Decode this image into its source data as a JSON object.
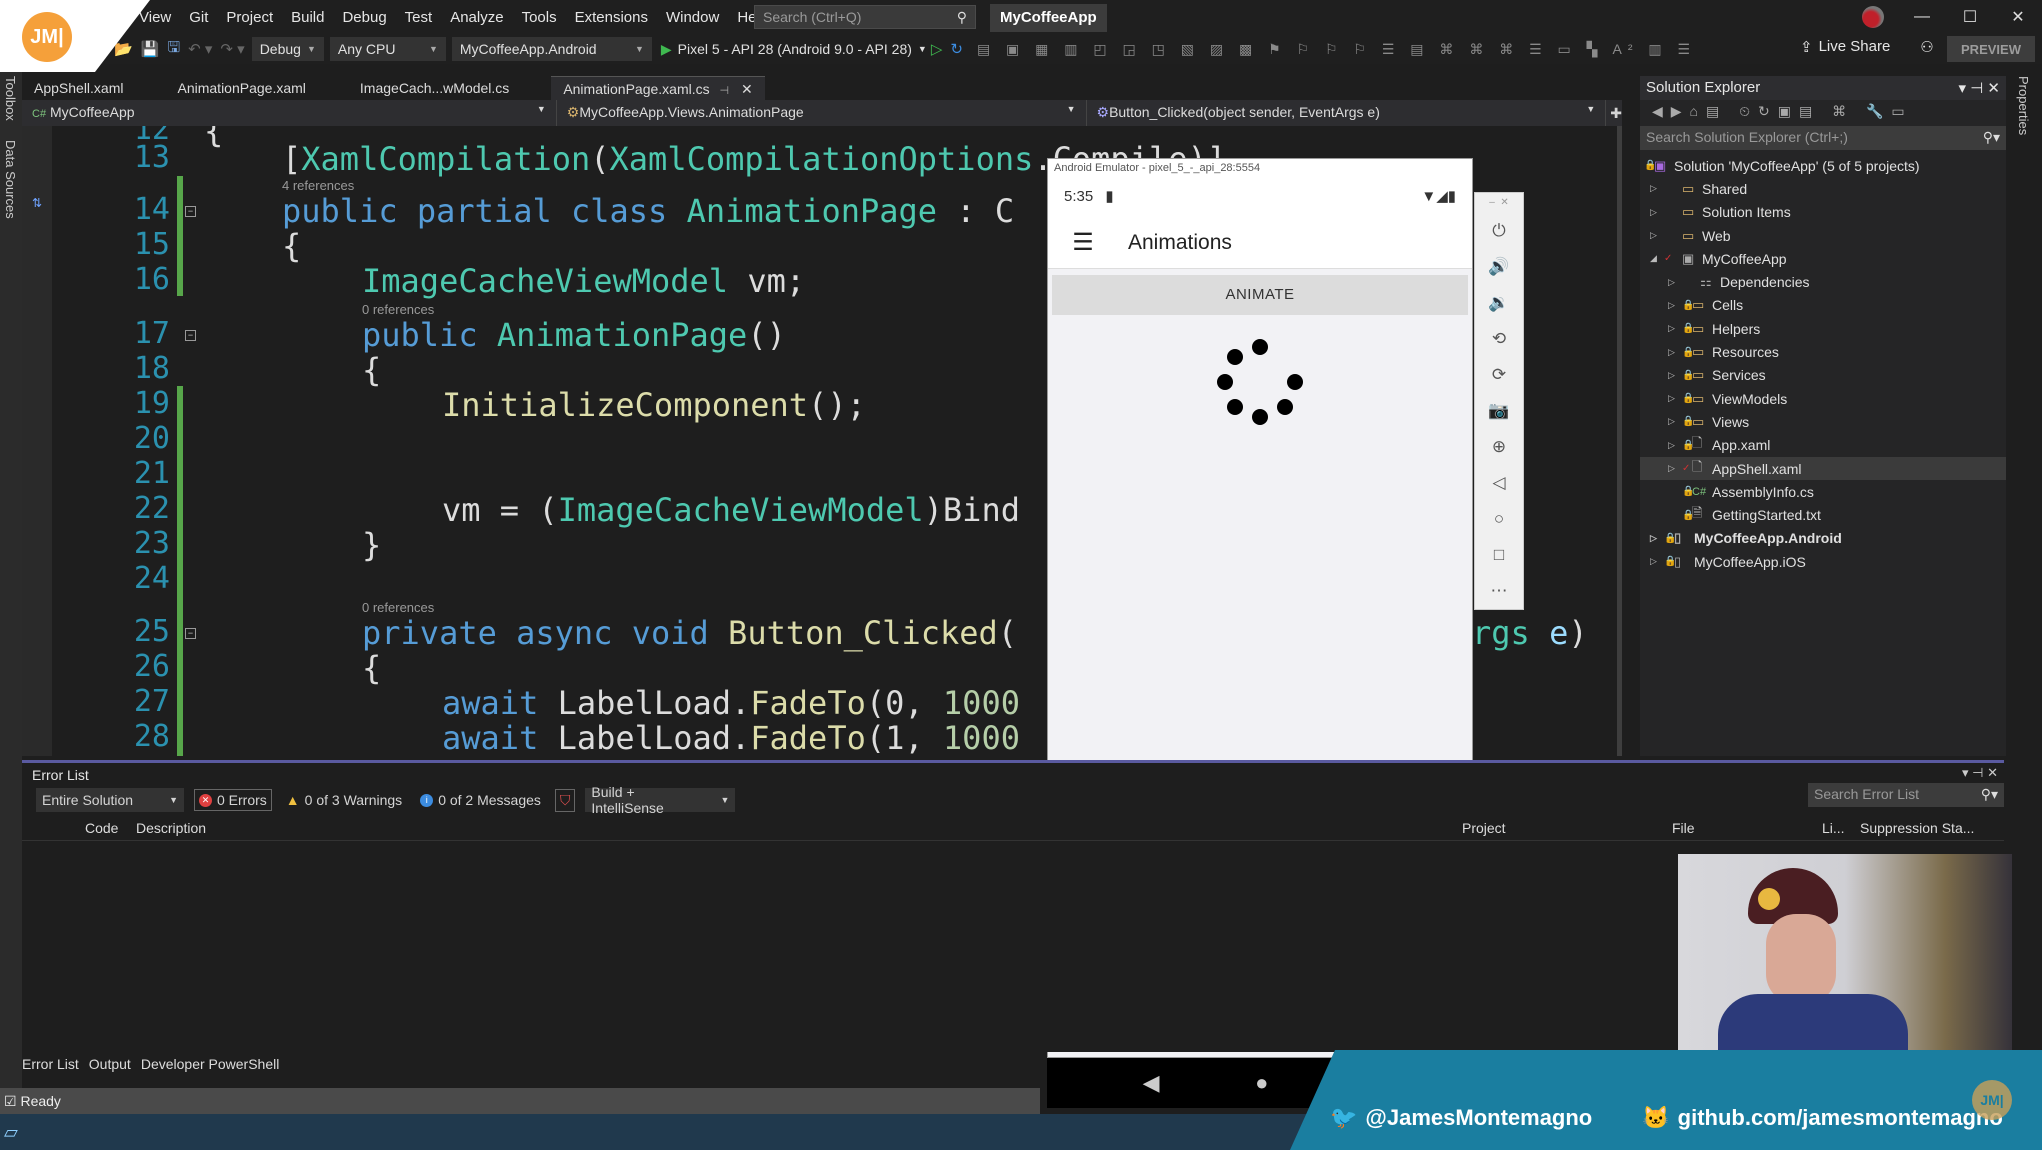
{
  "titlebar": {
    "menu": [
      "View",
      "Git",
      "Project",
      "Build",
      "Debug",
      "Test",
      "Analyze",
      "Tools",
      "Extensions",
      "Window",
      "Help"
    ],
    "search_placeholder": "Search (Ctrl+Q)",
    "app_title": "MyCoffeeApp",
    "live_share": "Live Share",
    "preview": "PREVIEW"
  },
  "toolbar": {
    "config": "Debug",
    "platform": "Any CPU",
    "startup_project": "MyCoffeeApp.Android",
    "run_target": "Pixel 5 - API 28 (Android 9.0 - API 28)"
  },
  "logo": {
    "text": "JM|",
    "color": "#f5a03a"
  },
  "left_rail": {
    "toolbox": "Toolbox",
    "data_sources": "Data Sources"
  },
  "tabs": [
    {
      "label": "AppShell.xaml"
    },
    {
      "label": "AnimationPage.xaml"
    },
    {
      "label": "ImageCach...wModel.cs"
    },
    {
      "label": "AnimationPage.xaml.cs",
      "active": true
    }
  ],
  "nav_bar": {
    "project": "MyCoffeeApp",
    "type": "MyCoffeeApp.Views.AnimationPage",
    "member": "Button_Clicked(object sender, EventArgs e)"
  },
  "editor": {
    "refs": {
      "l14": "4 references",
      "l17": "0 references",
      "l25": "0 references"
    },
    "lines": {
      "l12": "12",
      "l13": "13",
      "l14": "14",
      "l15": "15",
      "l16": "16",
      "l17": "17",
      "l18": "18",
      "l19": "19",
      "l20": "20",
      "l21": "21",
      "l22": "22",
      "l23": "23",
      "l24": "24",
      "l25": "25",
      "l26": "26",
      "l27": "27",
      "l28": "28"
    },
    "code": {
      "l13_a": "[",
      "l13_b": "XamlCompilation",
      "l13_c": "(",
      "l13_d": "XamlCompilationOptions",
      "l13_e": ".Compile)]",
      "l14_a": "public partial class ",
      "l14_b": "AnimationPage",
      "l14_c": " : C",
      "l15": "{",
      "l16_a": "ImageCacheViewModel",
      "l16_b": " vm;",
      "l17_a": "public ",
      "l17_b": "AnimationPage",
      "l17_c": "()",
      "l18": "{",
      "l19_a": "InitializeComponent",
      "l19_b": "();",
      "l22_a": "vm = (",
      "l22_b": "ImageCacheViewModel",
      "l22_c": ")Bind",
      "l23": "}",
      "l25_a": "private async void ",
      "l25_b": "Button_Clicked",
      "l25_c": "(",
      "l25_tail_a": "rgs",
      "l25_tail_b": " e",
      "l25_tail_c": ")",
      "l26": "{",
      "l27_a": "await ",
      "l27_b": "LabelLoad.",
      "l27_c": "FadeTo",
      "l27_d": "(0, ",
      "l27_e": "1000",
      "l28_a": "await ",
      "l28_b": "LabelLoad.",
      "l28_c": "FadeTo",
      "l28_d": "(1, ",
      "l28_e": "1000"
    }
  },
  "emulator": {
    "window_title": "Android Emulator - pixel_5_-_api_28:5554",
    "time": "5:35",
    "page_title": "Animations",
    "button": "ANIMATE"
  },
  "solution_explorer": {
    "title": "Solution Explorer",
    "search_placeholder": "Search Solution Explorer (Ctrl+;)",
    "items": [
      {
        "label": "Solution 'MyCoffeeApp' (5 of 5 projects)"
      },
      {
        "label": "Shared"
      },
      {
        "label": "Solution Items"
      },
      {
        "label": "Web"
      },
      {
        "label": "MyCoffeeApp"
      },
      {
        "label": "Dependencies"
      },
      {
        "label": "Cells"
      },
      {
        "label": "Helpers"
      },
      {
        "label": "Resources"
      },
      {
        "label": "Services"
      },
      {
        "label": "ViewModels"
      },
      {
        "label": "Views"
      },
      {
        "label": "App.xaml"
      },
      {
        "label": "AppShell.xaml",
        "selected": true
      },
      {
        "label": "AssemblyInfo.cs"
      },
      {
        "label": "GettingStarted.txt"
      },
      {
        "label": "MyCoffeeApp.Android",
        "bold": true
      },
      {
        "label": "MyCoffeeApp.iOS"
      }
    ]
  },
  "properties_rail": "Properties",
  "error_list": {
    "title": "Error List",
    "scope": "Entire Solution",
    "errors": "0 Errors",
    "warnings": "0 of 3 Warnings",
    "messages": "0 of 2 Messages",
    "source": "Build + IntelliSense",
    "search_placeholder": "Search Error List",
    "columns": [
      "Code",
      "Description",
      "Project",
      "File",
      "Li...",
      "Suppression Sta..."
    ]
  },
  "bottom_tabs": [
    "Error List",
    "Output",
    "Developer PowerShell"
  ],
  "status": "Ready",
  "overlay": {
    "twitter": "@JamesMontemagno",
    "github": "github.com/jamesmontemagno",
    "badge": "JM|"
  }
}
